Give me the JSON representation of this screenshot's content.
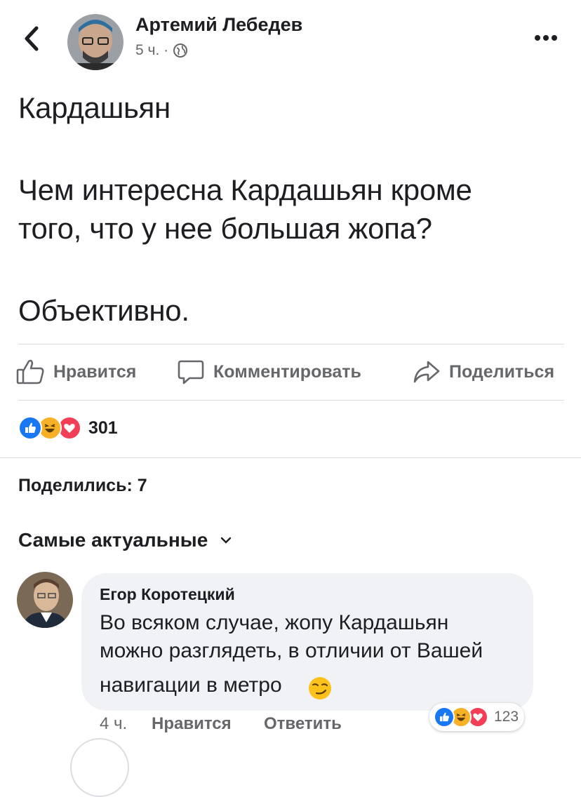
{
  "post": {
    "author": "Артемий Лебедев",
    "time": "5 ч. ·",
    "privacy_icon": "globe-icon",
    "title": "Кардашьян",
    "body_lines": [
      "Чем интересна Кардашьян кроме",
      "того, что у нее большая жопа?",
      "Объективно."
    ]
  },
  "actions": {
    "like": "Нравится",
    "comment": "Комментировать",
    "share": "Поделиться"
  },
  "reactions": {
    "icons": [
      "like-reaction-icon",
      "haha-reaction-icon",
      "love-reaction-icon"
    ],
    "count": "301"
  },
  "shares": "Поделились: 7",
  "sort": {
    "label": "Самые актуальные",
    "icon": "chevron-down-icon"
  },
  "comment": {
    "author": "Егор Коротецкий",
    "lines": [
      "Во всяком случае, жопу Кардашьян",
      "можно разглядеть, в отличии от Вашей",
      "навигации в метро"
    ],
    "emoji": "smirk-emoji",
    "time": "4 ч.",
    "like": "Нравится",
    "reply": "Ответить",
    "reactions": {
      "icons": [
        "like-reaction-icon",
        "haha-reaction-icon",
        "love-reaction-icon"
      ],
      "count": "123"
    }
  },
  "colors": {
    "like_blue": "#1877f2",
    "love_red": "#f33e58",
    "haha_yellow": "#f7b125",
    "secondary_text": "#65676b",
    "bubble_bg": "#f0f2f5"
  }
}
